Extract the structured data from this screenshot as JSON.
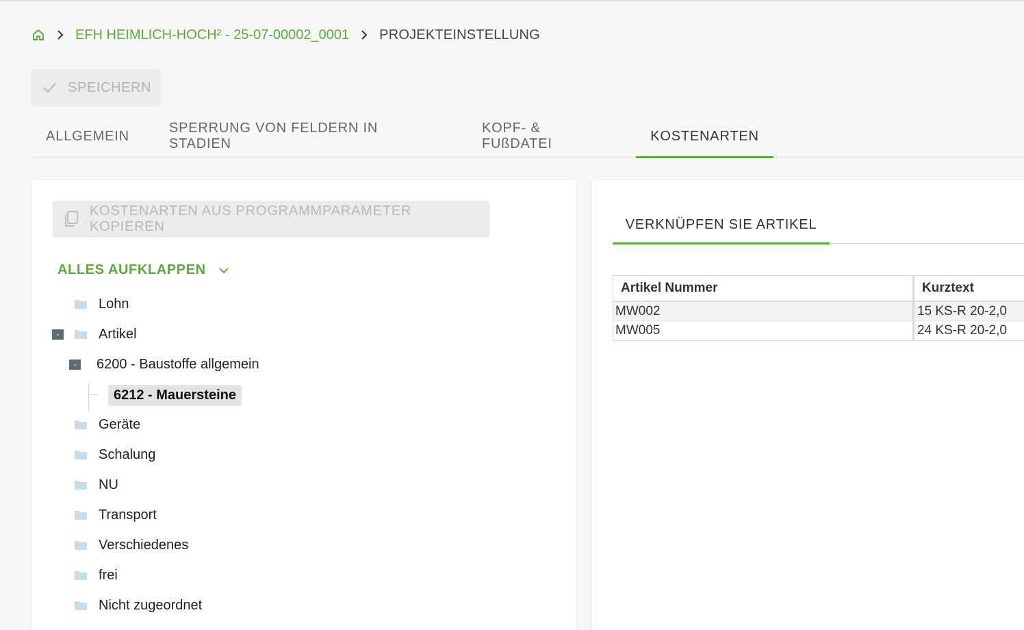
{
  "breadcrumb": {
    "project": "EFH HEIMLICH-HOCH² - 25-07-00002_0001",
    "current": "PROJEKTEINSTELLUNG"
  },
  "toolbar": {
    "save_label": "SPEICHERN"
  },
  "tabs": [
    {
      "label": "ALLGEMEIN",
      "active": false
    },
    {
      "label": "SPERRUNG VON FELDERN IN STADIEN",
      "active": false
    },
    {
      "label": "KOPF- & FUßDATEI",
      "active": false
    },
    {
      "label": "KOSTENARTEN",
      "active": true
    }
  ],
  "left_panel": {
    "copy_button_label": "KOSTENARTEN AUS PROGRAMMPARAMETER KOPIEREN",
    "expand_all_label": "ALLES AUFKLAPPEN",
    "tree": [
      {
        "label": "Lohn",
        "expanded": false
      },
      {
        "label": "Artikel",
        "expanded": true,
        "toggle": "-"
      },
      {
        "label": "6200 - Baustoffe allgemein",
        "expanded": true,
        "toggle": "-"
      },
      {
        "label": "6212 - Mauersteine",
        "selected": true
      },
      {
        "label": "Geräte"
      },
      {
        "label": "Schalung"
      },
      {
        "label": "NU"
      },
      {
        "label": "Transport"
      },
      {
        "label": "Verschiedenes"
      },
      {
        "label": "frei"
      },
      {
        "label": "Nicht zugeordnet"
      }
    ]
  },
  "right_panel": {
    "sub_tab_label": "VERKNÜPFEN SIE ARTIKEL",
    "columns": [
      "Artikel Nummer",
      "Kurztext"
    ],
    "rows": [
      [
        "MW002",
        "15 KS-R 20-2,0"
      ],
      [
        "MW005",
        "24 KS-R 20-2,0"
      ]
    ]
  },
  "colors": {
    "accent": "#5aab3c",
    "background": "#f7f7f7",
    "tree_toggle": "#5d6d76",
    "folder": "#c9dde8"
  },
  "icons": [
    "home-icon",
    "chevron-right-icon",
    "check-icon",
    "copy-icon",
    "chevron-down-icon",
    "folder-icon"
  ]
}
